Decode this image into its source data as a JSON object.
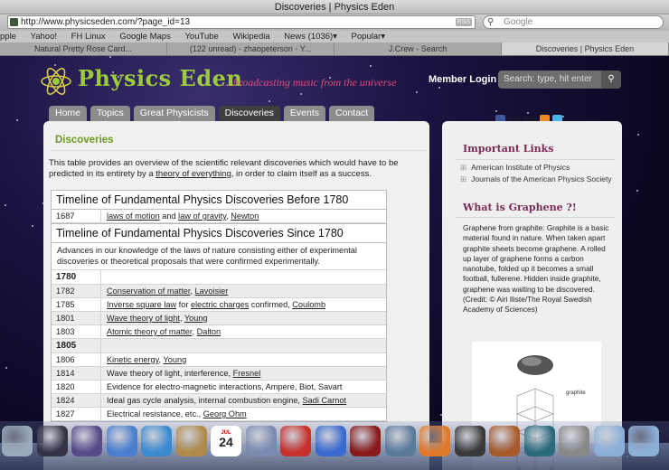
{
  "browser": {
    "window_title": "Discoveries | Physics Eden",
    "url": "http://www.physicseden.com/?page_id=13",
    "rss_badge": "RSS",
    "search_placeholder": "Google",
    "bookmarks": [
      "pple",
      "Yahoo!",
      "FH Linux",
      "Google Maps",
      "YouTube",
      "Wikipedia",
      "News (1036)▾",
      "Popular▾"
    ],
    "tabs": [
      {
        "label": "Natural Pretty Rose Card...",
        "active": false
      },
      {
        "label": "(122 unread) - zhaopeterson - Y...",
        "active": false
      },
      {
        "label": "J.Crew - Search",
        "active": false
      },
      {
        "label": "Discoveries | Physics Eden",
        "active": true
      }
    ]
  },
  "site": {
    "name": "Physics Eden",
    "tagline": "... broadcasting music from the universe",
    "member_login": "Member Login",
    "search_placeholder": "Search: type, hit enter",
    "nav": [
      {
        "label": "Home",
        "active": false
      },
      {
        "label": "Topics",
        "active": false
      },
      {
        "label": "Great Physicists",
        "active": false
      },
      {
        "label": "Discoveries",
        "active": true
      },
      {
        "label": "Events",
        "active": false
      },
      {
        "label": "Contact",
        "active": false
      }
    ],
    "rss_feed": "RSS Feed"
  },
  "main": {
    "title": "Discoveries",
    "intro_before": "This table provides an overview of the scientific relevant discoveries which would have to be predicted in its entirety by a ",
    "intro_link": "theory of everything",
    "intro_after": ", in order to claim itself as a success.",
    "table1_heading": "Timeline of Fundamental Physics Discoveries Before 1780",
    "table1_rows": [
      {
        "year": "1687",
        "parts": [
          {
            "t": "laws of motion",
            "link": true
          },
          {
            "t": " and ",
            "link": false
          },
          {
            "t": "law of gravity",
            "link": true
          },
          {
            "t": ", ",
            "link": false
          },
          {
            "t": "Newton",
            "link": true
          }
        ]
      }
    ],
    "table2_heading": "Timeline of Fundamental Physics Discoveries Since 1780",
    "table2_note": "Advances in our knowledge of the laws of nature consisting either of experimental discoveries or theoretical proposals that were confirmed experimentally.",
    "table2_rows": [
      {
        "year": "1780",
        "bold": true,
        "parts": []
      },
      {
        "year": "1782",
        "parts": [
          {
            "t": "Conservation of matter",
            "link": true
          },
          {
            "t": ", ",
            "link": false
          },
          {
            "t": "Lavoisier",
            "link": true
          }
        ]
      },
      {
        "year": "1785",
        "parts": [
          {
            "t": "Inverse square law",
            "link": true
          },
          {
            "t": " for ",
            "link": false
          },
          {
            "t": "electric charges",
            "link": true
          },
          {
            "t": " confirmed, ",
            "link": false
          },
          {
            "t": "Coulomb",
            "link": true
          }
        ]
      },
      {
        "year": "1801",
        "parts": [
          {
            "t": "Wave theory of light",
            "link": true
          },
          {
            "t": ", ",
            "link": false
          },
          {
            "t": "Young",
            "link": true
          }
        ]
      },
      {
        "year": "1803",
        "parts": [
          {
            "t": "Atomic theory of matter",
            "link": true
          },
          {
            "t": ", ",
            "link": false
          },
          {
            "t": "Dalton",
            "link": true
          }
        ]
      },
      {
        "year": "1805",
        "bold": true,
        "parts": []
      },
      {
        "year": "1806",
        "parts": [
          {
            "t": "Kinetic energy",
            "link": true
          },
          {
            "t": ", ",
            "link": false
          },
          {
            "t": "Young",
            "link": true
          }
        ]
      },
      {
        "year": "1814",
        "parts": [
          {
            "t": "Wave theory of light, interference, ",
            "link": false
          },
          {
            "t": "Fresnel",
            "link": true
          }
        ]
      },
      {
        "year": "1820",
        "parts": [
          {
            "t": "Evidence for electro-magnetic interactions, Ampere, Biot, Savart",
            "link": false
          }
        ]
      },
      {
        "year": "1824",
        "parts": [
          {
            "t": "Ideal gas cycle analysis, internal combustion engine, ",
            "link": false
          },
          {
            "t": "Sadi Carnot",
            "link": true
          }
        ]
      },
      {
        "year": "1827",
        "parts": [
          {
            "t": "Electrical resistance, etc., ",
            "link": false
          },
          {
            "t": "Georg Ohm",
            "link": true
          }
        ]
      }
    ]
  },
  "sidebar": {
    "links_title": "Important Links",
    "links": [
      "American Institute of Physics",
      "Journals of the American Physics Society"
    ],
    "graphene_title": "What is Graphene ?!",
    "graphene_text": "Graphene from graphite: Graphite is a basic material found in nature. When taken apart graphite sheets become graphene. A rolled up layer of graphene forms a carbon nanotube, folded up it becomes a small football, fullerene. Hidden inside graphite, graphene was waiting to be discovered. (Credit: © Airi Iliste/The Royal Swedish Academy of Sciences)",
    "figure_label": "graphite"
  },
  "dock": {
    "icons": [
      "finder-icon",
      "dashboard-icon",
      "mail-icon",
      "ichat-icon",
      "safari-icon",
      "address-book-icon",
      "ical-icon",
      "preview-icon",
      "filezilla-icon",
      "itunes-icon",
      "photo-booth-icon",
      "iphoto-icon",
      "firefox-icon",
      "imovie-icon",
      "garageband-icon",
      "time-machine-icon",
      "system-preferences-icon",
      "applications-folder-icon",
      "documents-folder-icon"
    ],
    "ical_day": "24",
    "ical_month": "JUL"
  }
}
